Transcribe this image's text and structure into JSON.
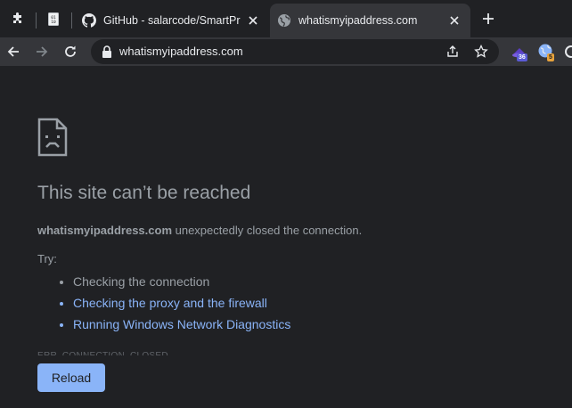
{
  "tabs": [
    {
      "title": "GitHub - salarcode/SmartProxy",
      "icon": "github-icon",
      "active": false
    },
    {
      "title": "whatismyipaddress.com",
      "icon": "globe-icon",
      "active": true
    }
  ],
  "toolbar": {
    "url": "whatismyipaddress.com",
    "extensions": [
      {
        "icon": "extension-hat-icon",
        "badge": "36",
        "badge_color": "#5b5bd6"
      },
      {
        "icon": "extension-globe-icon",
        "badge": "5",
        "badge_color": "#e8a33c"
      }
    ]
  },
  "error_page": {
    "heading": "This site can’t be reached",
    "host": "whatismyipaddress.com",
    "message": " unexpectedly closed the connection.",
    "try_label": "Try:",
    "suggestions": [
      {
        "text": "Checking the connection",
        "is_link": false
      },
      {
        "text": "Checking the proxy and the firewall",
        "is_link": true
      },
      {
        "text": "Running Windows Network Diagnostics",
        "is_link": true
      }
    ],
    "error_code": "ERR_CONNECTION_CLOSED",
    "reload_label": "Reload"
  },
  "colors": {
    "background": "#202124",
    "toolbar": "#35363a",
    "link": "#8ab4f8",
    "button": "#8ab4f8"
  }
}
